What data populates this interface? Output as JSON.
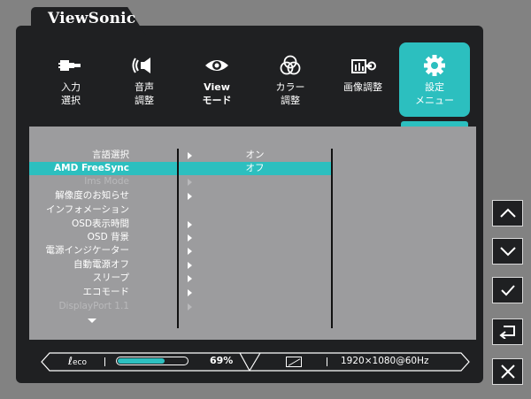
{
  "brand": "ViewSonic",
  "tabs": [
    {
      "icon": "input-plug-icon",
      "label": "入力\n選択"
    },
    {
      "icon": "speaker-icon",
      "label": "音声\n調整"
    },
    {
      "icon": "eye-icon",
      "label": "View\nモード"
    },
    {
      "icon": "color-circles-icon",
      "label": "カラー\n調整"
    },
    {
      "icon": "image-adjust-icon",
      "label": "画像調整"
    },
    {
      "icon": "gear-icon",
      "label": "設定\nメニュー"
    }
  ],
  "menu": [
    {
      "label": "言語選択"
    },
    {
      "label": "AMD FreeSync"
    },
    {
      "label": "Ims Mode"
    },
    {
      "label": "解像度のお知らせ"
    },
    {
      "label": "インフォメーション"
    },
    {
      "label": "OSD表示時間"
    },
    {
      "label": "OSD 背景"
    },
    {
      "label": "電源インジケーター"
    },
    {
      "label": "自動電源オフ"
    },
    {
      "label": "スリープ"
    },
    {
      "label": "エコモード"
    },
    {
      "label": "DisplayPort 1.1"
    }
  ],
  "options": [
    "オン",
    "オフ"
  ],
  "status": {
    "eco_label": "eco",
    "eco_level": 0.69,
    "eco_percent": "69%",
    "resolution": "1920×1080@60Hz"
  },
  "colors": {
    "accent": "#2cbfbf",
    "frame": "#1f2022",
    "panel": "#9c9c9e"
  },
  "side_buttons": [
    "chevron-up-icon",
    "chevron-down-icon",
    "check-icon",
    "return-icon",
    "close-icon"
  ]
}
